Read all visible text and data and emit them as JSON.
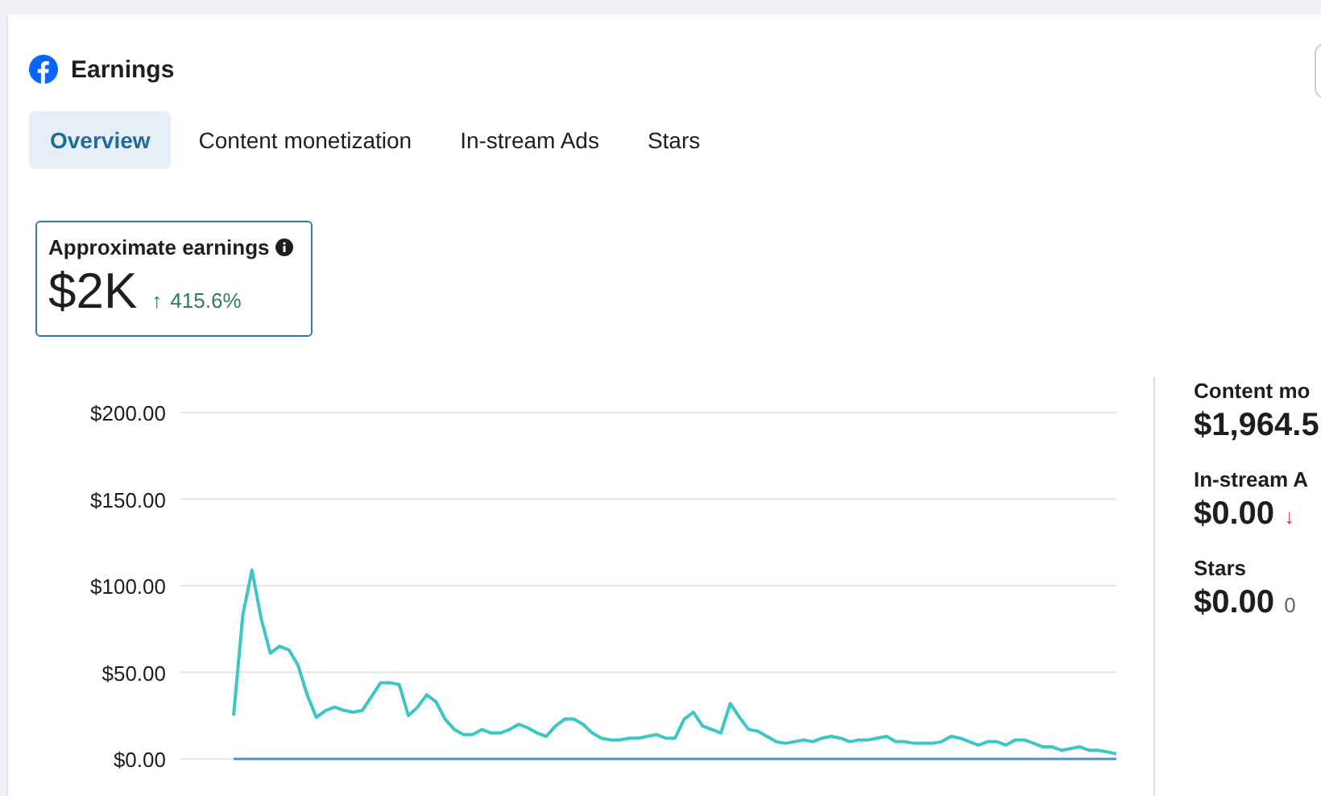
{
  "header": {
    "title": "Earnings"
  },
  "tabs": [
    {
      "label": "Overview",
      "selected": true
    },
    {
      "label": "Content monetization",
      "selected": false
    },
    {
      "label": "In-stream Ads",
      "selected": false
    },
    {
      "label": "Stars",
      "selected": false
    }
  ],
  "summary": {
    "title": "Approximate earnings",
    "value": "$2K",
    "change_icon": "↑",
    "change": "415.6%"
  },
  "chart": {
    "chart_data": {
      "type": "line",
      "grid": true,
      "ylim": [
        0,
        200
      ],
      "yticks": [
        {
          "value": 0,
          "label": "$0.00"
        },
        {
          "value": 50,
          "label": "$50.00"
        },
        {
          "value": 100,
          "label": "$100.00"
        },
        {
          "value": 150,
          "label": "$150.00"
        },
        {
          "value": 200,
          "label": "$200.00"
        }
      ],
      "series": [
        {
          "color": "#3cc6c4",
          "values": [
            25,
            83,
            109,
            81,
            61,
            65,
            63,
            54,
            37,
            24,
            28,
            30,
            28,
            27,
            28,
            36,
            44,
            44,
            43,
            25,
            30,
            37,
            33,
            23,
            17,
            14,
            14,
            17,
            15,
            15,
            17,
            20,
            18,
            15,
            13,
            19,
            23,
            23,
            20,
            15,
            12,
            11,
            11,
            12,
            12,
            13,
            14,
            12,
            12,
            23,
            27,
            19,
            17,
            15,
            32,
            24,
            17,
            16,
            13,
            10,
            9,
            10,
            11,
            10,
            12,
            13,
            12,
            10,
            11,
            11,
            12,
            13,
            10,
            10,
            9,
            9,
            9,
            10,
            13,
            12,
            10,
            8,
            10,
            10,
            8,
            11,
            11,
            9,
            7,
            7,
            5,
            6,
            7,
            5,
            5,
            4,
            3
          ]
        }
      ]
    }
  },
  "breakdown": [
    {
      "label": "Content mo",
      "value": "$1,964.5"
    },
    {
      "label": "In-stream A",
      "value": "$0.00",
      "change_icon": "↓"
    },
    {
      "label": "Stars",
      "value": "$0.00",
      "change": "0"
    }
  ]
}
